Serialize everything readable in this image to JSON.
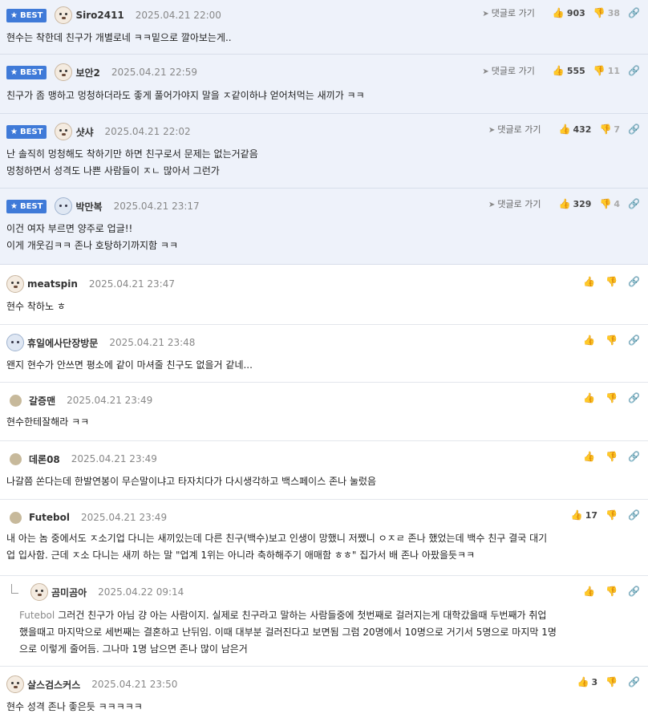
{
  "ui": {
    "reply_label": "댓글로 가기",
    "best_label": "BEST"
  },
  "comments": [
    {
      "nick": "Siro2411",
      "date": "2025.04.21 22:00",
      "up": "903",
      "down": "38",
      "lines": [
        "현수는 착한데 친구가 개별로네 ㅋㅋ밑으로 깔아보는게.."
      ]
    },
    {
      "nick": "보안2",
      "date": "2025.04.21 22:59",
      "up": "555",
      "down": "11",
      "lines": [
        "친구가 좀 맹하고 멍청하더라도 좋게 풀어가야지 말을 ㅈ같이하냐 얻어처먹는 새끼가 ㅋㅋ"
      ]
    },
    {
      "nick": "샷샤",
      "date": "2025.04.21 22:02",
      "up": "432",
      "down": "7",
      "lines": [
        "난 솔직히 멍청해도 착하기만 하면 친구로서 문제는 없는거같음",
        "멍청하면서 성격도 나쁜 사람들이 ㅈㄴ 많아서 그런가"
      ]
    },
    {
      "nick": "박만복",
      "date": "2025.04.21 23:17",
      "up": "329",
      "down": "4",
      "lines": [
        "이건 여자 부르면 양주로 업글!!",
        "이게 개웃김ㅋㅋ 존나 호탕하기까지함 ㅋㅋ"
      ]
    },
    {
      "nick": "meatspin",
      "date": "2025.04.21 23:47",
      "lines": [
        "현수 착하노 ㅎ"
      ]
    },
    {
      "nick": "휴일에사단장방문",
      "date": "2025.04.21 23:48",
      "lines": [
        "왠지 현수가 안쓰면 평소에 같이 마셔줄 친구도 없을거 같네..."
      ]
    },
    {
      "nick": "갈증맨",
      "date": "2025.04.21 23:49",
      "lines": [
        "현수한테잘해라 ㅋㅋ"
      ]
    },
    {
      "nick": "데론08",
      "date": "2025.04.21 23:49",
      "lines": [
        "나갈쯤 쏜다는데 한발연봉이 무슨말이냐고 타자치다가 다시생각하고 백스페이스 존나 눌렀음"
      ]
    },
    {
      "nick": "Futebol",
      "date": "2025.04.21 23:49",
      "up": "17",
      "lines": [
        "내 아는 놈 중에서도 ㅈ소기업 다니는 새끼있는데 다른 친구(백수)보고 인생이 망했니 저쨌니 ㅇㅈㄹ 존나 했었는데 백수 친구 결국 대기",
        "업 입사함. 근데 ㅈ소 다니는 새끼 하는 말 \"업계 1위는 아니라 축하해주기 애매함 ㅎㅎ\" 집가서 배 존나 아팠을듯ㅋㅋ"
      ]
    },
    {
      "nick": "곰미곰아",
      "date": "2025.04.22 09:14",
      "quote": "Futebol",
      "lines": [
        "그러건 친구가 아님 걍 아는 사람이지. 실제로 친구라고 말하는 사람들중에 첫번째로 걸러지는게 대학갔을때 두번째가 취업",
        "했을때고 마지막으로 세번째는 결혼하고 난뒤임. 이때 대부분 걸러진다고 보면됨 그럼 20명에서 10명으로 거기서 5명으로 마지막 1명",
        "으로 이렇게 줄어듬. 그나마 1명 남으면 존나 많이 남은거"
      ]
    },
    {
      "nick": "살스검스커스",
      "date": "2025.04.21 23:50",
      "up": "3",
      "lines": [
        "현수 성격 존나 좋은듯 ㅋㅋㅋㅋㅋ"
      ]
    }
  ]
}
